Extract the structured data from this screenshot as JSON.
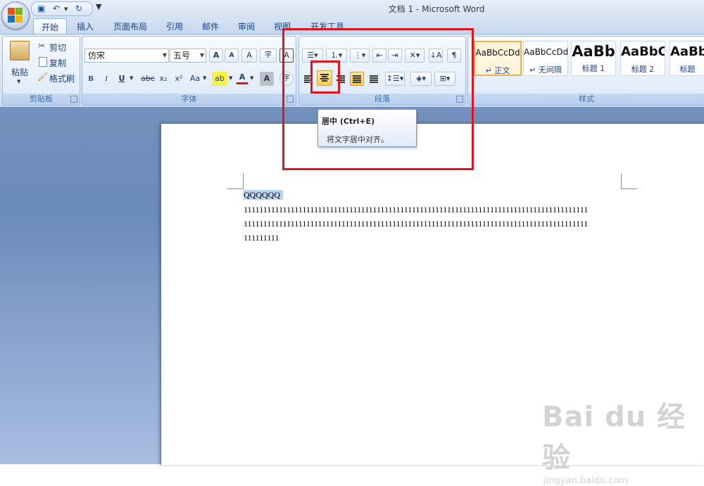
{
  "window": {
    "title": "文档 1 - Microsoft Word"
  },
  "quick_access": {
    "save": "▣",
    "undo": "↶",
    "redo": "↻",
    "more": "▼"
  },
  "tabs": [
    {
      "label": "开始",
      "active": true
    },
    {
      "label": "插入"
    },
    {
      "label": "页面布局"
    },
    {
      "label": "引用"
    },
    {
      "label": "邮件"
    },
    {
      "label": "审阅"
    },
    {
      "label": "视图"
    },
    {
      "label": "开发工具"
    }
  ],
  "ribbon": {
    "clipboard": {
      "label": "剪贴板",
      "paste": "粘贴",
      "cut": "剪切",
      "copy": "复制",
      "format_painter": "格式刷"
    },
    "font": {
      "label": "字体",
      "font_name": "仿宋",
      "font_size": "五号",
      "grow": "A",
      "shrink": "A",
      "clear": "A",
      "phonetic": "字",
      "border": "A",
      "bold": "B",
      "italic": "I",
      "underline": "U",
      "strike": "abc",
      "sub": "x₂",
      "sup": "x²",
      "case": "Aa",
      "highlight": "ab",
      "color": "A",
      "shade": "A",
      "enclose": "字"
    },
    "paragraph": {
      "label": "段落"
    },
    "styles": {
      "label": "样式",
      "items": [
        {
          "sample": "AaBbCcDd",
          "name": "↵ 正文",
          "selected": true
        },
        {
          "sample": "AaBbCcDd",
          "name": "↵ 无间隔"
        },
        {
          "sample": "AaBb",
          "name": "标题 1"
        },
        {
          "sample": "AaBbC",
          "name": "标题 2"
        },
        {
          "sample": "AaBb",
          "name": "标题"
        }
      ]
    }
  },
  "tooltip": {
    "title": "居中 (Ctrl+E)",
    "description": "将文字居中对齐。"
  },
  "document": {
    "lines": [
      "QQQQQQ",
      "1111111111111111111111111111111111111111111111111111111111111111111111111111111111111111",
      "1111111111111111111111111111111111111111111111111111111111111111111111111111111111111111",
      "111111111"
    ]
  },
  "watermark": {
    "main": "Bai du 经验",
    "sub": "jingyan.baidu.com"
  },
  "colors": {
    "annotation_red": "#e0141d",
    "ribbon_blue": "#d7e4f5",
    "highlight_selected": "#f0b04a"
  }
}
